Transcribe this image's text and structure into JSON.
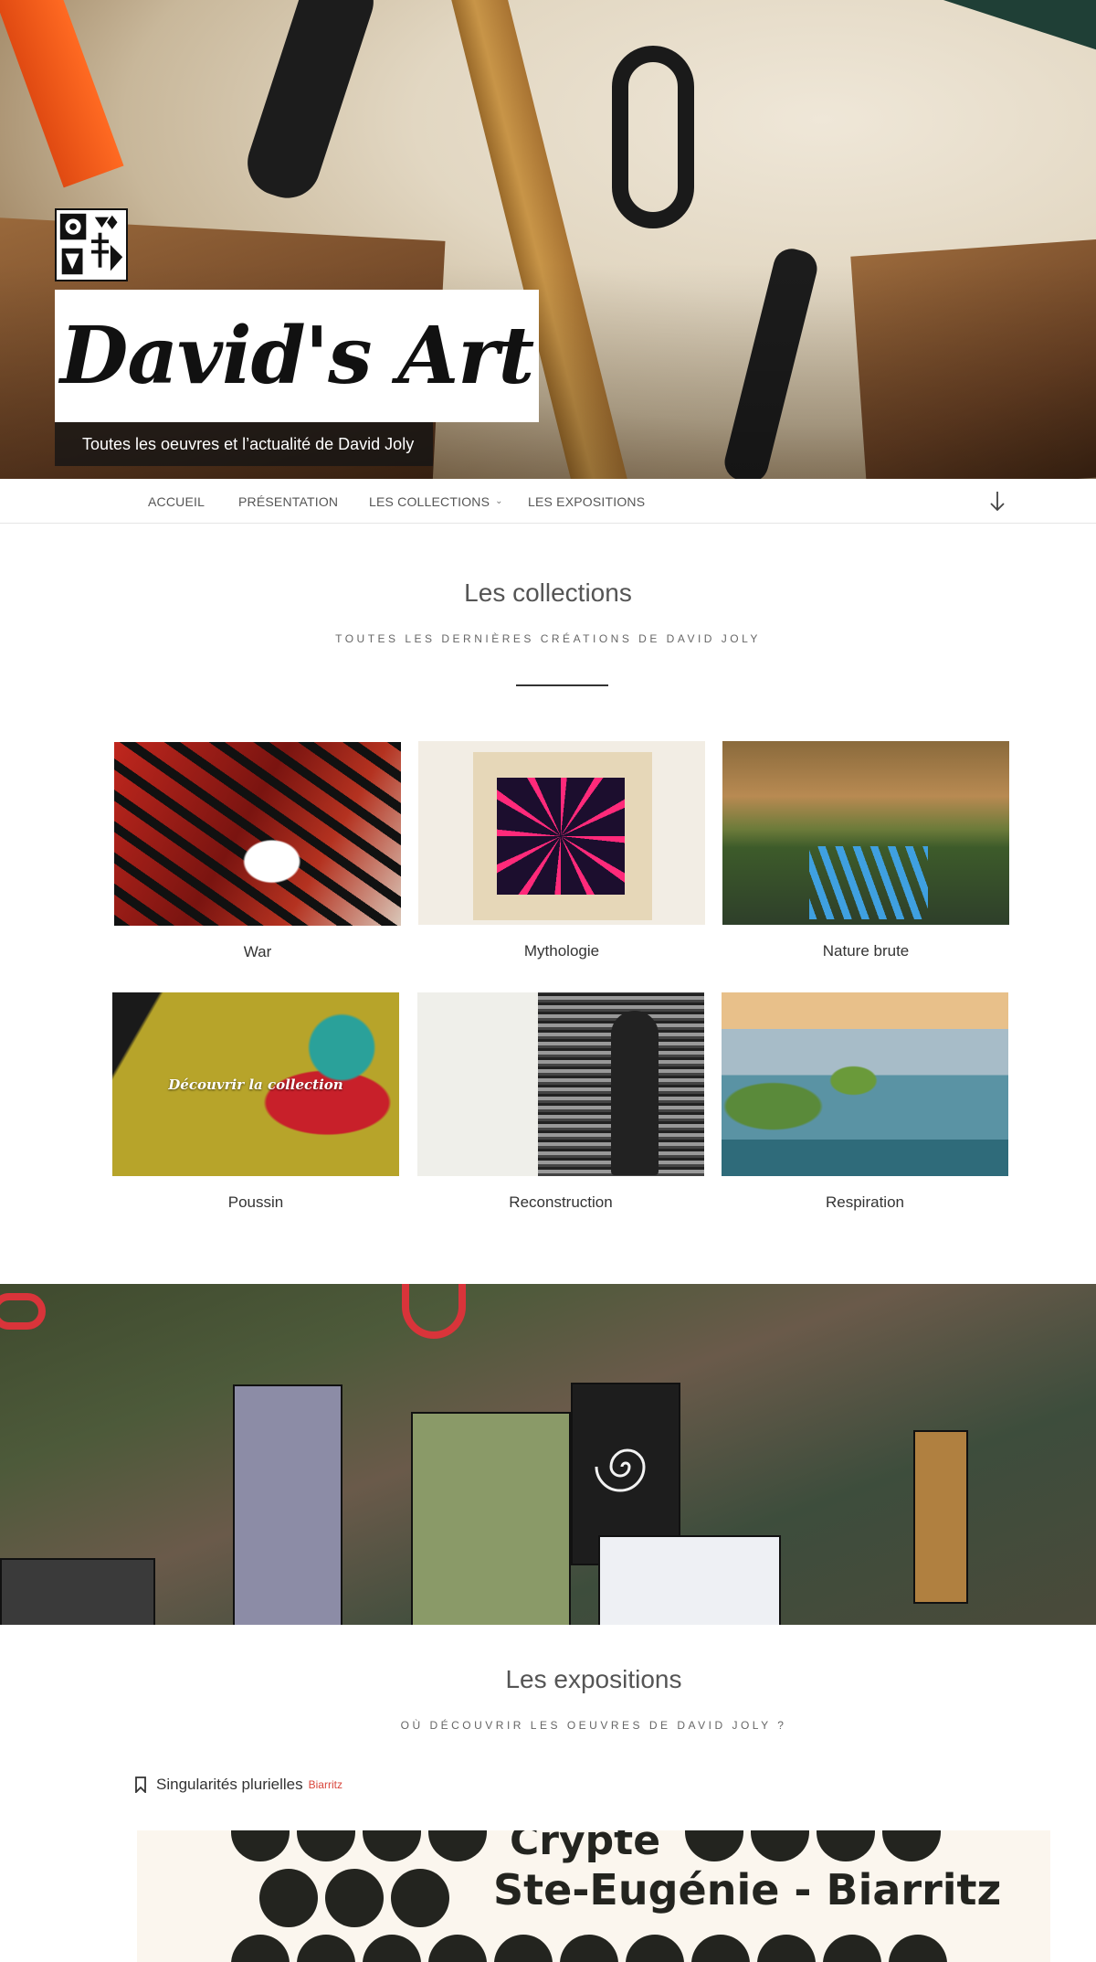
{
  "hero": {
    "site_title": "David's Art",
    "tagline": "Toutes les oeuvres et l’actualité de David Joly",
    "logo_icon": "tribal-logo-icon"
  },
  "nav": {
    "items": [
      {
        "label": "Accueil"
      },
      {
        "label": "Présentation"
      },
      {
        "label": "Les collections",
        "chevron": "chevron-down-icon"
      },
      {
        "label": "Les expositions"
      }
    ],
    "scroll_icon": "arrow-down-icon"
  },
  "collections": {
    "title": "Les collections",
    "subtitle": "Toutes les dernières créations de David Joly",
    "overlay_text": "Découvrir la collection",
    "items": [
      {
        "label": "War"
      },
      {
        "label": "Mythologie"
      },
      {
        "label": "Nature brute"
      },
      {
        "label": "Poussin"
      },
      {
        "label": "Reconstruction"
      },
      {
        "label": "Respiration"
      }
    ]
  },
  "expositions": {
    "title": "Les expositions",
    "subtitle": "Où découvrir les oeuvres de David Joly ?",
    "items": [
      {
        "name": "Singularités plurielles",
        "city": "Biarritz",
        "icon": "bookmark-icon"
      }
    ],
    "poster_lines": [
      "Crypte",
      "Ste-Eugénie - Biarritz"
    ]
  },
  "colors": {
    "accent_red": "#d9443a",
    "text": "#333333",
    "nav_text": "#555555"
  }
}
